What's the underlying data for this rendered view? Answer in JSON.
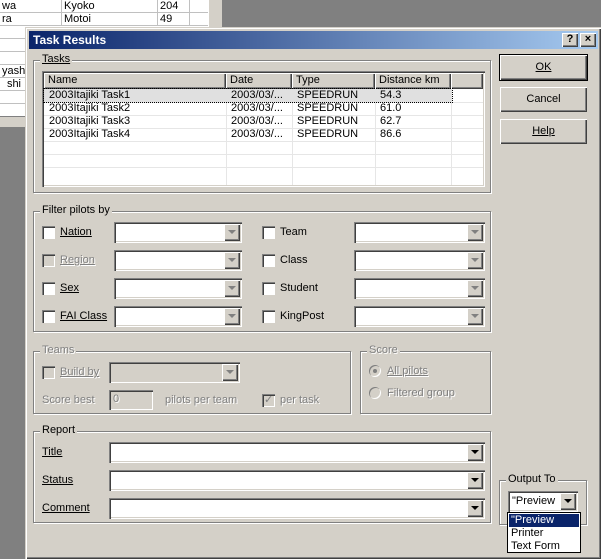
{
  "background_sheet": {
    "rows": [
      [
        "wa",
        "Kyoko",
        "204"
      ],
      [
        "ra",
        "Motoi",
        "49"
      ],
      [
        "",
        "",
        ""
      ],
      [
        "",
        "",
        ""
      ],
      [
        "",
        "",
        ""
      ],
      [
        "yashi",
        "",
        ""
      ],
      [
        "shi",
        "",
        ""
      ],
      [
        "",
        "",
        ""
      ]
    ]
  },
  "dialog": {
    "title": "Task Results",
    "help_glyph": "?",
    "close_glyph": "×"
  },
  "tasks": {
    "label": "Tasks",
    "columns": [
      "Name",
      "Date",
      "Type",
      "Distance km"
    ],
    "rows": [
      [
        "2003Itajiki Task1",
        "2003/03/...",
        "SPEEDRUN",
        "54.3"
      ],
      [
        "2003Itajiki Task2",
        "2003/03/...",
        "SPEEDRUN",
        "61.0"
      ],
      [
        "2003Itajiki Task3",
        "2003/03/...",
        "SPEEDRUN",
        "62.7"
      ],
      [
        "2003Itajiki Task4",
        "2003/03/...",
        "SPEEDRUN",
        "86.6"
      ]
    ]
  },
  "buttons": {
    "ok": "OK",
    "cancel": "Cancel",
    "help": "Help"
  },
  "filter": {
    "label": "Filter pilots by",
    "nation": "Nation",
    "region": "Region",
    "sex": "Sex",
    "fai_class": "FAI Class",
    "team": "Team",
    "class": "Class",
    "student": "Student",
    "kingpost": "KingPost"
  },
  "teams": {
    "label": "Teams",
    "build_by": "Build by",
    "score_best": "Score best",
    "score_best_value": "0",
    "pilots_per_team": "pilots per team",
    "per_task": "per task",
    "per_task_checked": true
  },
  "score": {
    "label": "Score",
    "all_pilots": "All pilots",
    "filtered_group": "Filtered group",
    "selected": "all_pilots"
  },
  "report": {
    "label": "Report",
    "title": "Title",
    "status": "Status",
    "comment": "Comment"
  },
  "output": {
    "label": "Output To",
    "value": "\"Preview",
    "options": [
      "\"Preview",
      "Printer",
      "Text Form"
    ],
    "selected_index": 0
  },
  "colors": {
    "title_gradient_start": "#0a246a",
    "title_gradient_end": "#a6caf0",
    "face": "#d4d0c8",
    "selection": "#0a246a"
  }
}
